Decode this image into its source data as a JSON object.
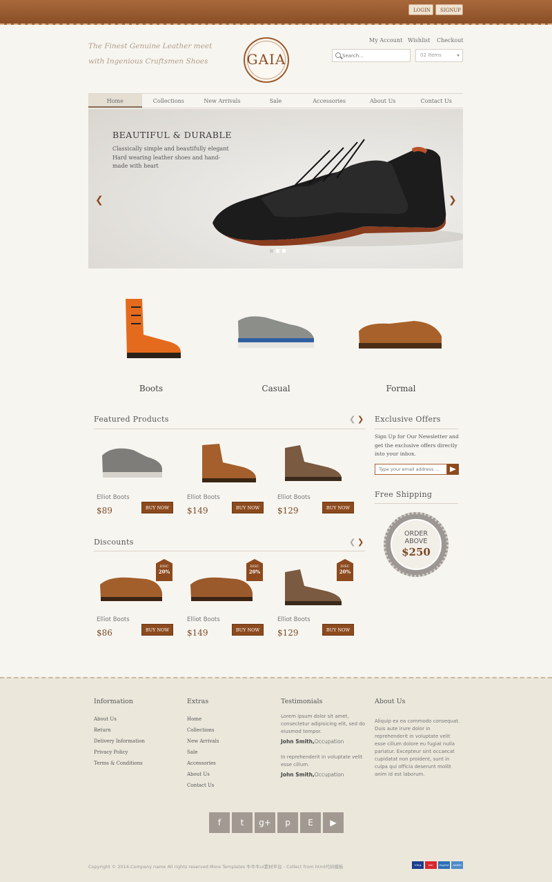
{
  "topbar": {
    "login": "LOGIN",
    "signup": "SIGNUP"
  },
  "header": {
    "tagline": "The Finest Genuine Leather meet with Ingenious Craftsmen Shoes",
    "logo": "GAIA",
    "links": {
      "account": "My Account",
      "wishlist": "Wishlist",
      "checkout": "Checkout"
    },
    "search_placeholder": "Search...",
    "cart": "02 Items"
  },
  "nav": [
    "Home",
    "Collections",
    "New Arrivals",
    "Sale",
    "Accessories",
    "About Us",
    "Contact Us"
  ],
  "hero": {
    "title": "BEAUTIFUL & DURABLE",
    "text": "Classically simple and beautifully elegant Hard wearing leather shoes and hand-made with heart",
    "prev": "❮",
    "next": "❯"
  },
  "categories": [
    "Boots",
    "Casual",
    "Formal"
  ],
  "featured": {
    "title": "Featured Products",
    "items": [
      {
        "name": "Elliot Boots",
        "price": "$89",
        "button": "BUY NOW"
      },
      {
        "name": "Elliot Boots",
        "price": "$149",
        "button": "BUY NOW"
      },
      {
        "name": "Elliot Boots",
        "price": "$129",
        "button": "BUY NOW"
      }
    ]
  },
  "discounts": {
    "title": "Discounts",
    "tag_label": "DISC",
    "tag_value": "20%",
    "items": [
      {
        "name": "Elliot Boots",
        "price": "$86",
        "button": "BUY NOW"
      },
      {
        "name": "Elliot Boots",
        "price": "$149",
        "button": "BUY NOW"
      },
      {
        "name": "Elliot Boots",
        "price": "$129",
        "button": "BUY NOW"
      }
    ]
  },
  "offers": {
    "title": "Exclusive Offers",
    "text": "Sign Up for Our Newsletter and get the exclusive offers directly into your inbox.",
    "email_placeholder": "Type your email address ..."
  },
  "shipping": {
    "title": "Free Shipping",
    "line1": "ORDER",
    "line2": "ABOVE",
    "amount": "$250"
  },
  "footer": {
    "information": {
      "title": "Information",
      "links": [
        "About Us",
        "Return",
        "Delivery Information",
        "Privacy Policy",
        "Terms & Conditions"
      ]
    },
    "extras": {
      "title": "Extras",
      "links": [
        "Home",
        "Collections",
        "New Arrivals",
        "Sale",
        "Accessories",
        "About Us",
        "Contact Us"
      ]
    },
    "testimonials": {
      "title": "Testimonials",
      "t1": "Lorem ipsum dolor sit amet, consectetur adipisicing elit, sed do eiusmod tempor.",
      "author1": "John Smith,",
      "occ1": "Occupation",
      "t2": "In reprehenderit in voluptate velit esse cillum.",
      "author2": "John Smith,",
      "occ2": "Occupation"
    },
    "about": {
      "title": "About Us",
      "text": "Aliquip ex ea commodo consequat. Duis aute irure dolor in reprehenderit in voluptate velit esse cillum dolore eu fugiat nulla pariatur. Excepteur sint occaecat cupidatat non proident, sunt in culpa qui officia deserunt mollit anim id est laborum."
    },
    "social": [
      "f",
      "t",
      "g+",
      "p",
      "E",
      "▶"
    ],
    "copyright": "Copyright © 2014.Company name All rights reserved.More Templates 牛牛牛ui素材平台 - Collect from html代码模板",
    "cards": [
      "VISA",
      "MC",
      "PayPal",
      "AMEX"
    ]
  },
  "colors": {
    "accent": "#8c4a1e",
    "background": "#f7f5f0",
    "footer": "#ebe7db"
  }
}
